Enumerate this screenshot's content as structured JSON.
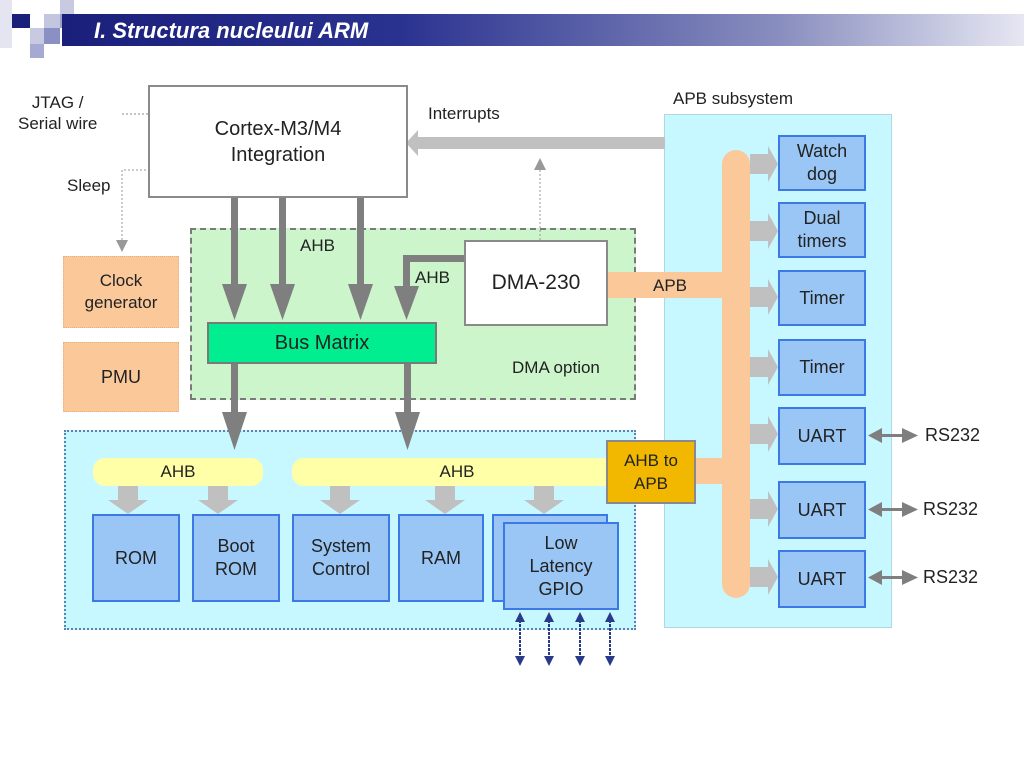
{
  "slide": {
    "title": "I. Structura nucleului ARM"
  },
  "diagram": {
    "core": {
      "line1": "Cortex-M3/M4",
      "line2": "Integration"
    },
    "jtag": {
      "line1": "JTAG /",
      "line2": "Serial wire"
    },
    "sleep_label": "Sleep",
    "interrupts_label": "Interrupts",
    "clock_generator": {
      "line1": "Clock",
      "line2": "generator"
    },
    "pmu": "PMU",
    "dma_option": {
      "ahb_label": "AHB",
      "ahb_dma_label": "AHB",
      "bus_matrix": "Bus Matrix",
      "dma": "DMA-230",
      "option_label": "DMA option",
      "apb_label": "APB"
    },
    "ahb_subsystem": {
      "ahb_left": "AHB",
      "ahb_right": "AHB",
      "blocks": [
        {
          "line1": "ROM",
          "line2": ""
        },
        {
          "line1": "Boot",
          "line2": "ROM"
        },
        {
          "line1": "System",
          "line2": "Control"
        },
        {
          "line1": "RAM",
          "line2": ""
        }
      ],
      "gpio": {
        "line1": "Low",
        "line2": "Latency",
        "line3": "GPIO"
      },
      "bridge": {
        "line1": "AHB to",
        "line2": "APB"
      }
    },
    "apb_subsystem": {
      "label": "APB subsystem",
      "peripherals": [
        {
          "line1": "Watch",
          "line2": "dog"
        },
        {
          "line1": "Dual",
          "line2": "timers"
        },
        {
          "line1": "Timer",
          "line2": ""
        },
        {
          "line1": "Timer",
          "line2": ""
        },
        {
          "line1": "UART",
          "line2": "",
          "io": "RS232"
        },
        {
          "line1": "UART",
          "line2": "",
          "io": "RS232"
        },
        {
          "line1": "UART",
          "line2": "",
          "io": "RS232"
        }
      ]
    }
  }
}
